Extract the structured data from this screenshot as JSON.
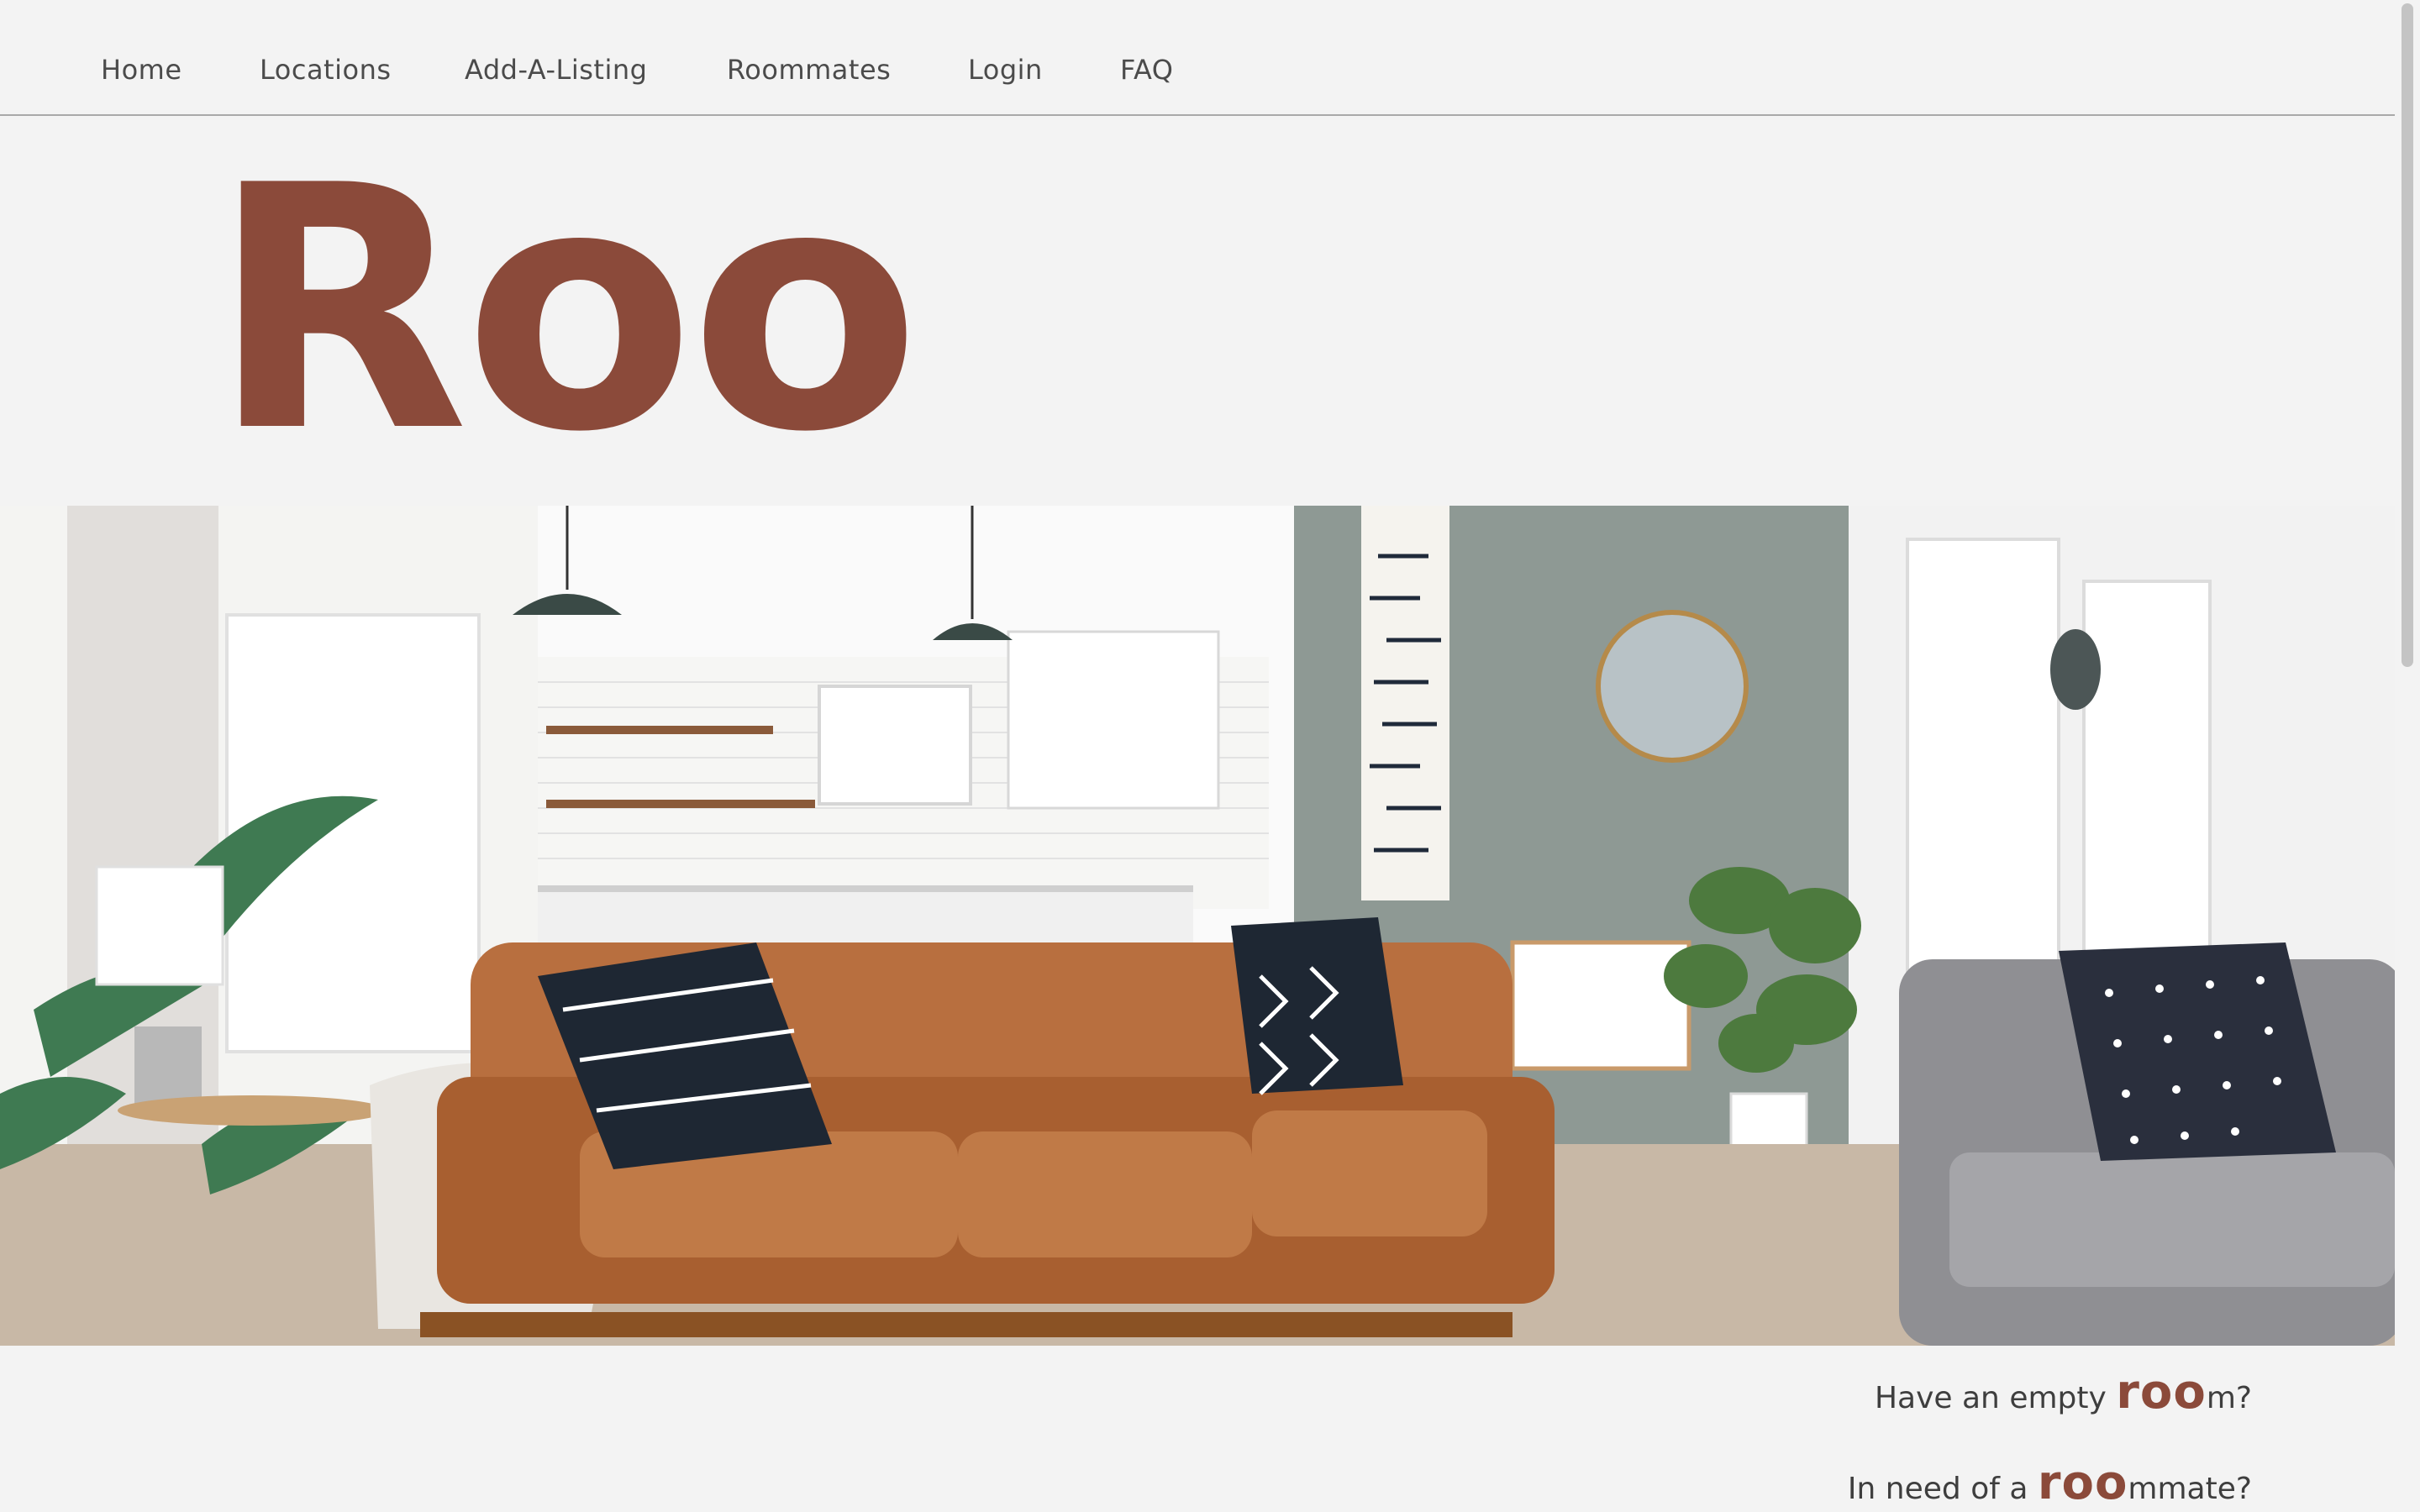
{
  "nav": {
    "items": [
      {
        "label": "Home"
      },
      {
        "label": "Locations"
      },
      {
        "label": "Add-A-Listing"
      },
      {
        "label": "Roommates"
      },
      {
        "label": "Login"
      },
      {
        "label": "FAQ"
      }
    ]
  },
  "hero": {
    "title": "Roo"
  },
  "taglines": [
    {
      "before": "Have an empty ",
      "accent": "roo",
      "after": "m?"
    },
    {
      "before": "In need of a ",
      "accent": "roo",
      "after": "mmate?"
    }
  ],
  "colors": {
    "brand": "#8b4a3a",
    "background": "#f3f3f3",
    "nav_text": "#4b4b4b"
  },
  "banner": {
    "icon": "living-room-photo"
  }
}
